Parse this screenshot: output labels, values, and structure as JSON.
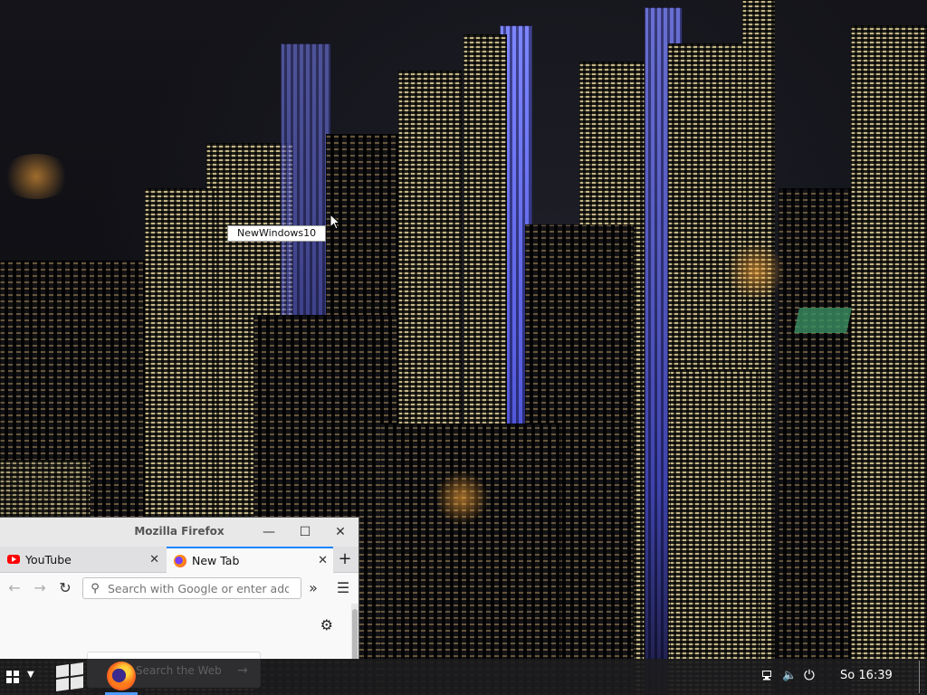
{
  "desktop": {
    "tooltip": "NewWindows10"
  },
  "firefox": {
    "window_title": "Mozilla Firefox",
    "tabs": [
      {
        "label": "YouTube",
        "icon": "youtube-icon",
        "active": false
      },
      {
        "label": "New Tab",
        "icon": "firefox-icon",
        "active": true
      }
    ],
    "urlbar_placeholder": "Search with Google or enter addre",
    "page_search_placeholder": "Search the Web"
  },
  "taskbar": {
    "clock": "So 16:39",
    "accent_color": "#4c9bff"
  },
  "icons": {
    "minimize": "minimize-icon",
    "maximize": "maximize-icon",
    "close": "close-icon",
    "back": "back-arrow-icon",
    "forward": "forward-arrow-icon",
    "reload": "reload-icon",
    "overflow": "overflow-chevron-icon",
    "menu": "hamburger-menu-icon",
    "settings": "gear-icon"
  }
}
